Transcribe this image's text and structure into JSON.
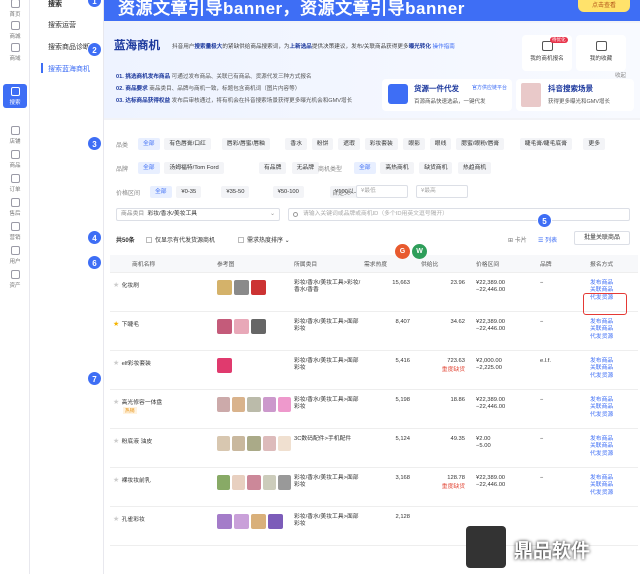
{
  "banner": {
    "text": "资源文章引导banner，资源文章引导banner",
    "cta": "点击查看"
  },
  "rail": [
    {
      "label": "首页",
      "icon": "home-icon"
    },
    {
      "label": "商城",
      "icon": "shop-icon"
    },
    {
      "label": "商域",
      "icon": "grid-icon"
    },
    {
      "label": "搜索",
      "icon": "search-icon"
    },
    {
      "label": "店铺",
      "icon": "store-icon"
    },
    {
      "label": "商品",
      "icon": "goods-icon"
    },
    {
      "label": "订单",
      "icon": "order-icon"
    },
    {
      "label": "售后",
      "icon": "after-sales-icon"
    },
    {
      "label": "营销",
      "icon": "marketing-icon"
    },
    {
      "label": "用户",
      "icon": "user-icon"
    },
    {
      "label": "资产",
      "icon": "asset-icon"
    }
  ],
  "subnav": {
    "items": [
      "搜索",
      "搜索运营",
      "搜索商品诊断",
      "搜索蓝海商机"
    ]
  },
  "header": {
    "brand": "蓝海商机",
    "intro_1": "抖音用户",
    "intro_hl1": "搜索量极大",
    "intro_2": "的紧缺供给商品搜索词，为",
    "intro_hl2": "上新选品",
    "intro_3": "提供决策建议，发布/关联商品获得更多",
    "intro_hl3": "曝光转化",
    "intro_link": "操作指南",
    "benefits": [
      {
        "num": "01.",
        "title": "挑选商机发布商品",
        "text": "可通过发布商品、关联已有商品、货源代发三种方式报名"
      },
      {
        "num": "02.",
        "title": "商品要求",
        "text": "商品类目、品牌与商机一致，标题包含商机词（图片内容等）"
      },
      {
        "num": "03.",
        "title": "达标商品获得权益",
        "text": "发布后审核通过，将有机会在抖音搜索场景获得更多曝光机会和GMV增长"
      }
    ],
    "quick": [
      {
        "label": "我的商机报名",
        "badge": "待优化"
      },
      {
        "label": "我的收藏"
      }
    ],
    "collapse": "收起",
    "promos": [
      {
        "title": "货源一件代发",
        "badge": "官方供应链平台",
        "sub": "百源商品快速选品，一键代发"
      },
      {
        "title": "抖音搜索场景",
        "sub": "获得更多曝光和GMV增长"
      }
    ]
  },
  "filters": {
    "category_label": "品类",
    "categories": [
      "全部",
      "有色唇膏/口红",
      "唇彩/唇蜜/唇釉",
      "香水",
      "粉饼",
      "遮瑕",
      "彩妆套装",
      "眼影",
      "眼线",
      "腮蜜/眼粉/唇膏",
      "睫毛膏/睫毛底膏",
      "更多"
    ],
    "brand_label": "品牌",
    "brands": [
      "全部",
      "汤姆福特/Tom Ford",
      "有品牌",
      "无品牌"
    ],
    "type_label": "商机类型",
    "types": [
      "全部",
      "高热商机",
      "缺货商机",
      "热趋商机"
    ],
    "price_label": "价格区间",
    "prices": [
      "全部",
      "¥0-35",
      "¥35-50",
      "¥50-100",
      "¥100以上"
    ],
    "custom_label": "自定义",
    "custom_min": "¥最低",
    "custom_max": "¥最高",
    "cat_select_label": "商品类目",
    "cat_select_value": "彩妆/香水/美妆工具",
    "search_placeholder": "请输入关键词或品牌或商机ID（多个ID用英文逗号隔开）"
  },
  "toolbar": {
    "total": "共50条",
    "only_supply": "仅显示有代发货源商机",
    "sort": "需求热度排序",
    "card_view": "卡片",
    "list_view": "列表",
    "bulk": "批量关联商品"
  },
  "table": {
    "headers": [
      "商机名称",
      "参考图",
      "所属类目",
      "需求热度",
      "供给比",
      "价格区间",
      "品牌",
      "报名方式"
    ],
    "rows": [
      {
        "starred": false,
        "name": "化妆刷",
        "category": "彩妆/香水/美妆工具>彩妆/香水/香香",
        "heat": "15,663",
        "ratio": "23.96",
        "tag": "",
        "price": "¥22,389.00\n−22,446.00",
        "brand": "−",
        "actions": [
          "发布商品",
          "关联商品",
          "代发货源"
        ],
        "colors": [
          "#d4b26a",
          "#8a8a8a",
          "#c33"
        ]
      },
      {
        "starred": true,
        "name": "下睫毛",
        "category": "彩妆/香水/美妆工具>面部彩妆",
        "heat": "8,407",
        "ratio": "34.62",
        "tag": "",
        "price": "¥22,389.00\n−22,446.00",
        "brand": "−",
        "actions": [
          "发布商品",
          "关联商品",
          "代发货源"
        ],
        "colors": [
          "#c45b7a",
          "#e8a8b8",
          "#666"
        ]
      },
      {
        "starred": false,
        "name": "elf彩妆套装",
        "category": "彩妆/香水/美妆工具>面部彩妆",
        "heat": "5,416",
        "ratio": "723.63",
        "tag": "重度缺货",
        "price": "¥2,000.00\n−2,225.00",
        "brand": "e.l.f.",
        "actions": [
          "发布商品",
          "关联商品",
          "代发货源"
        ],
        "colors": [
          "#e03a6e"
        ]
      },
      {
        "starred": false,
        "name": "高光修容一体盘",
        "tag2": "热销",
        "category": "彩妆/香水/美妆工具>面部彩妆",
        "heat": "5,198",
        "ratio": "18.86",
        "tag": "",
        "price": "¥22,389.00\n−22,446.00",
        "brand": "−",
        "actions": [
          "发布商品",
          "关联商品",
          "代发货源"
        ],
        "colors": [
          "#caa",
          "#d9b38c",
          "#bba",
          "#c9c",
          "#e9c"
        ]
      },
      {
        "starred": false,
        "name": "粉底液 油皮",
        "category": "3C数码配件>手机配件",
        "heat": "5,124",
        "ratio": "49.35",
        "tag": "",
        "price": "¥2.00\n−5.00",
        "brand": "−",
        "actions": [
          "发布商品",
          "关联商品",
          "代发货源"
        ],
        "colors": [
          "#d8c7b0",
          "#c9b89e",
          "#aa8",
          "#dbb",
          "#f0e0d0"
        ]
      },
      {
        "starred": false,
        "name": "裸妆妆前乳",
        "category": "彩妆/香水/美妆工具>面部彩妆",
        "heat": "3,168",
        "ratio": "128.78",
        "tag": "重度缺货",
        "price": "¥22,389.00\n−22,446.00",
        "brand": "−",
        "actions": [
          "发布商品",
          "关联商品",
          "代发货源"
        ],
        "colors": [
          "#8a6",
          "#e8d0c0",
          "#c89",
          "#ccb",
          "#999"
        ]
      },
      {
        "starred": false,
        "name": "孔雀彩妆",
        "category": "彩妆/香水/美妆工具>面部彩妆",
        "heat": "2,128",
        "ratio": "",
        "tag": "",
        "price": "",
        "brand": "",
        "actions": [],
        "colors": [
          "#a47cc9",
          "#c9a0d9",
          "#d9b07a",
          "#7c5cb9"
        ]
      }
    ]
  },
  "markers": [
    "1",
    "2",
    "3",
    "4",
    "5",
    "6",
    "7"
  ],
  "avatars": [
    "G",
    "W"
  ],
  "watermark": "鼎品软件"
}
